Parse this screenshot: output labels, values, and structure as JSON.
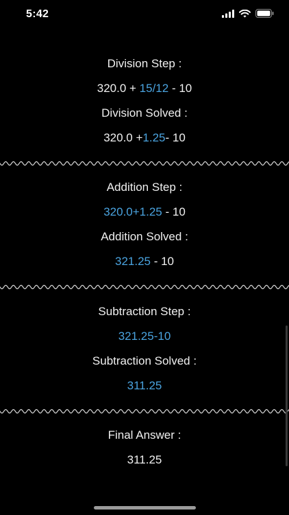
{
  "status_bar": {
    "time": "5:42"
  },
  "steps": {
    "division_step_label": "Division Step :",
    "division_step_expr": {
      "pre": "320.0 + ",
      "hl": "15/12",
      "post": " - 10"
    },
    "division_solved_label": "Division Solved :",
    "division_solved_expr": {
      "pre": "320.0 +",
      "hl": "1.25",
      "post": "- 10"
    },
    "addition_step_label": "Addition Step :",
    "addition_step_expr": {
      "pre": "",
      "hl": "320.0+1.25",
      "post": " - 10"
    },
    "addition_solved_label": "Addition Solved :",
    "addition_solved_expr": {
      "pre": "",
      "hl": "321.25",
      "post": " - 10"
    },
    "subtraction_step_label": "Subtraction Step :",
    "subtraction_step_expr": {
      "pre": "",
      "hl": "321.25-10",
      "post": ""
    },
    "subtraction_solved_label": "Subtraction Solved :",
    "subtraction_solved_expr": {
      "pre": "",
      "hl": "311.25",
      "post": ""
    },
    "final_answer_label": "Final Answer :",
    "final_answer_value": "311.25"
  },
  "colors": {
    "background": "#000000",
    "text": "#f0f0f0",
    "highlight": "#4aa3df",
    "divider": "#d8d8d8"
  }
}
